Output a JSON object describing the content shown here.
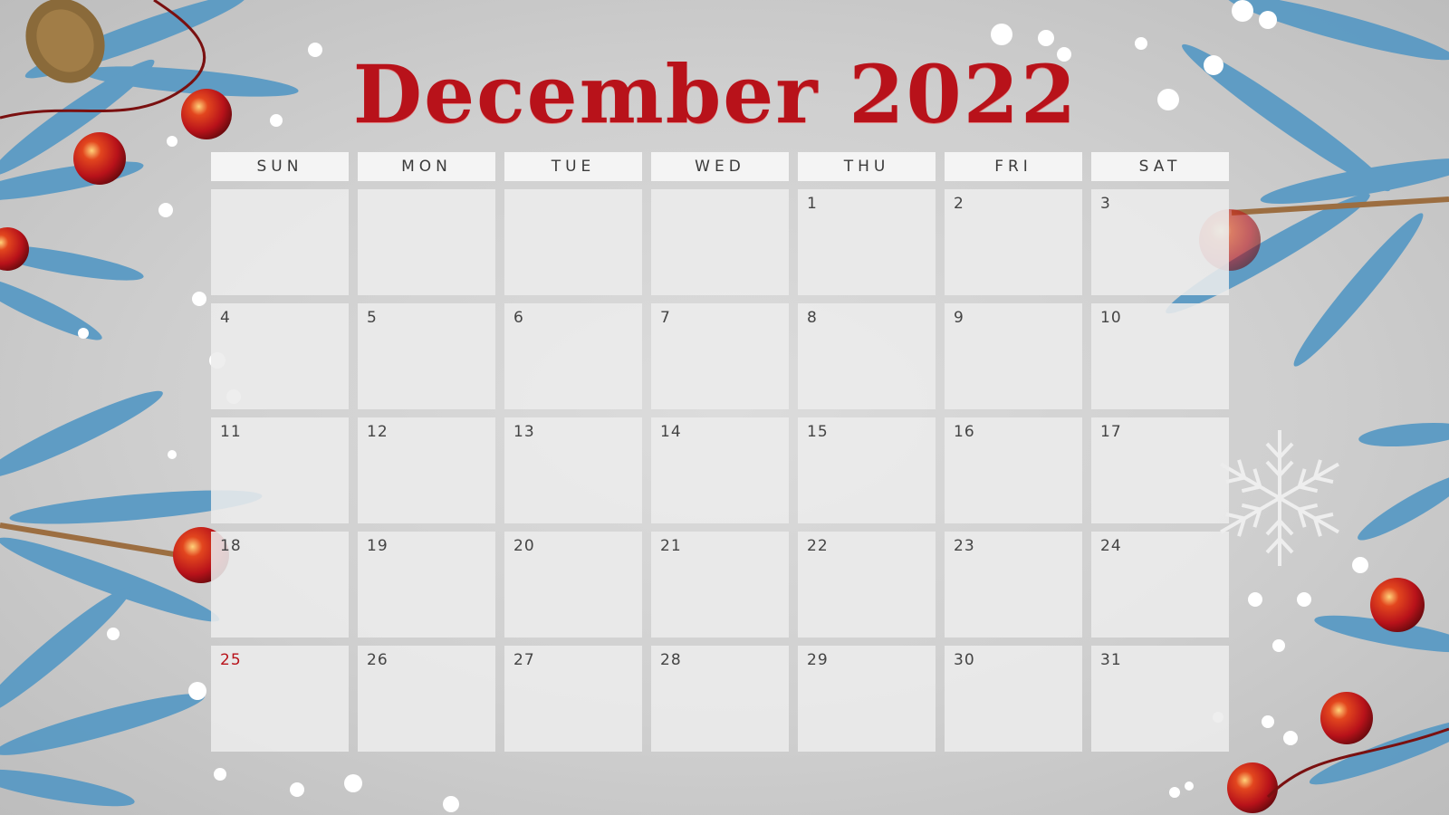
{
  "title": "December 2022",
  "weekdays": [
    "SUN",
    "MON",
    "TUE",
    "WED",
    "THU",
    "FRI",
    "SAT"
  ],
  "weeks": [
    [
      "",
      "",
      "",
      "",
      "1",
      "2",
      "3"
    ],
    [
      "4",
      "5",
      "6",
      "7",
      "8",
      "9",
      "10"
    ],
    [
      "11",
      "12",
      "13",
      "14",
      "15",
      "16",
      "17"
    ],
    [
      "18",
      "19",
      "20",
      "21",
      "22",
      "23",
      "24"
    ],
    [
      "25",
      "26",
      "27",
      "28",
      "29",
      "30",
      "31"
    ]
  ],
  "highlighted_date": "25",
  "colors": {
    "title": "#b8121a",
    "holiday": "#b8121a",
    "branch": "#4f8fb8",
    "ornament": "#c0141c"
  },
  "decorations": [
    "pine-branches",
    "red-ornaments",
    "pine-cone",
    "snowflake",
    "snow-dots"
  ]
}
